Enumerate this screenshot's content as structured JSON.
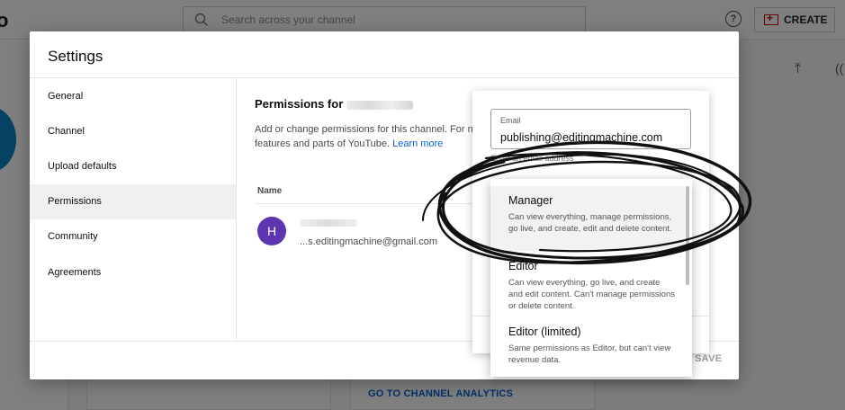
{
  "background": {
    "search_placeholder": "Search across your channel",
    "help_glyph": "?",
    "create_label": "CREATE",
    "analytics_link": "GO TO CHANNEL ANALYTICS"
  },
  "modal": {
    "title": "Settings",
    "nav": [
      "General",
      "Channel",
      "Upload defaults",
      "Permissions",
      "Community",
      "Agreements"
    ],
    "active_nav": "Permissions",
    "save_label": "SAVE"
  },
  "permissions": {
    "title_prefix": "Permissions for",
    "description_line1": "Add or change permissions for this channel. For no",
    "description_line2": "features and parts of YouTube.",
    "learn_more": "Learn more",
    "column_name": "Name",
    "user": {
      "initial": "H",
      "email_visible": "...s.editingmachine@gmail.com"
    }
  },
  "invite": {
    "email_label": "Email",
    "email_value": "publishing@editingmachine.com",
    "hint": "Enter an email address",
    "roles": [
      {
        "title": "Manager",
        "desc": "Can view everything, manage permissions, go live, and create, edit and delete content."
      },
      {
        "title": "Editor",
        "desc": "Can view everything, go live, and create and edit content. Can't manage permissions or delete content."
      },
      {
        "title": "Editor (limited)",
        "desc": "Same permissions as Editor, but can't view revenue data."
      }
    ],
    "highlighted_role": "Manager"
  },
  "colors": {
    "link": "#065fd4",
    "avatar": "#5e35b1",
    "brand_red": "#cc0000",
    "annotation": "#111111"
  }
}
